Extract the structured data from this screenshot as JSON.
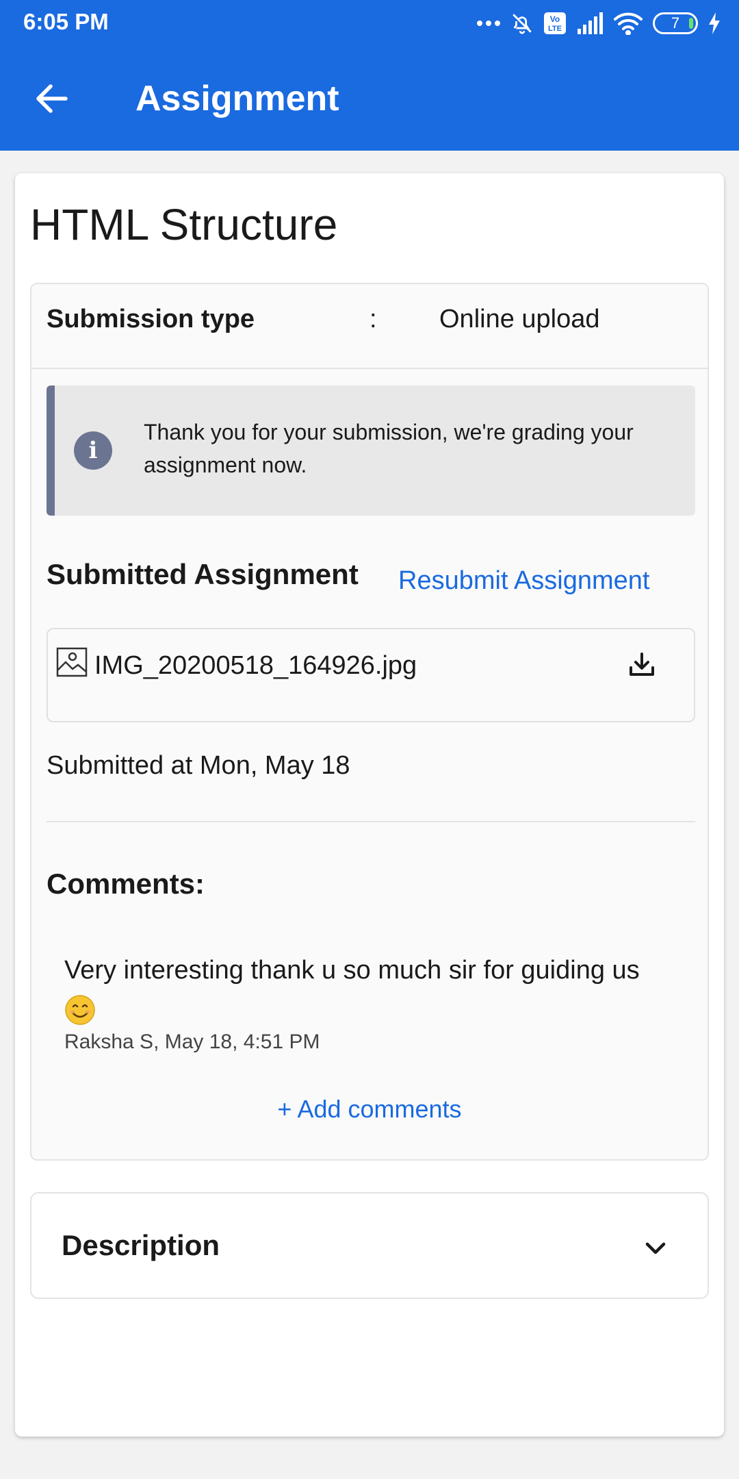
{
  "status_bar": {
    "time": "6:05 PM",
    "battery": "7",
    "icons": [
      "more-dots-icon",
      "bell-off-icon",
      "volte-icon",
      "signal-icon",
      "wifi-icon",
      "battery-icon",
      "charging-icon"
    ]
  },
  "toolbar": {
    "title": "Assignment",
    "back_icon": "arrow-left-icon"
  },
  "assignment": {
    "title": "HTML Structure",
    "submission_type_label": "Submission type",
    "submission_type_separator": ":",
    "submission_type_value": "Online upload",
    "info_message": "Thank you for your submission, we're grading your assignment now.",
    "submitted_heading": "Submitted Assignment",
    "resubmit_label": "Resubmit Assignment",
    "file": {
      "name": "IMG_20200518_164926.jpg",
      "icon": "image-icon",
      "action_icon": "download-icon"
    },
    "submitted_at": "Submitted at Mon, May 18"
  },
  "comments": {
    "heading": "Comments:",
    "items": [
      {
        "text": "Very interesting thank u so much sir for guiding us",
        "emoji": "smiling-face-emoji",
        "author_time": "Raksha S, May 18, 4:51 PM"
      }
    ],
    "add_label": "+ Add comments"
  },
  "description": {
    "label": "Description",
    "toggle_icon": "chevron-down-icon"
  },
  "colors": {
    "brand": "#1a6ae0",
    "info_accent": "#6b7591",
    "info_bg": "#e8e8e8",
    "link": "#1a6ae0"
  }
}
